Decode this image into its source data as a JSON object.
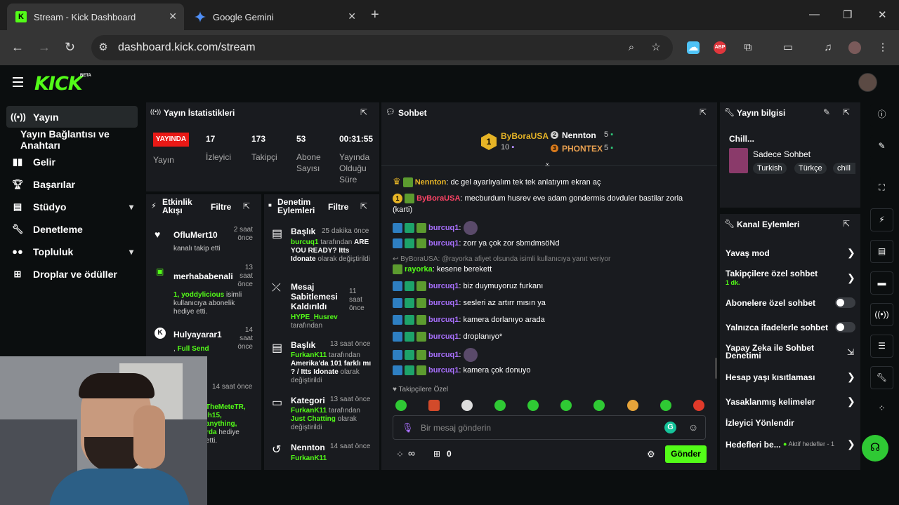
{
  "browser": {
    "tabs": [
      {
        "title": "Stream - Kick Dashboard",
        "active": true
      },
      {
        "title": "Google Gemini",
        "active": false
      }
    ],
    "url": "dashboard.kick.com/stream",
    "ext_abp": "ABP"
  },
  "kick": {
    "logo": "KICK",
    "beta": "BETA"
  },
  "sidebar": {
    "items": [
      {
        "label": "Yayın",
        "icon": "broadcast-icon"
      },
      {
        "label": "Yayın Bağlantısı ve Anahtarı",
        "icon": ""
      },
      {
        "label": "Gelir",
        "icon": "chart-icon"
      },
      {
        "label": "Başarılar",
        "icon": "trophy-icon"
      },
      {
        "label": "Stüdyo",
        "icon": "studio-icon"
      },
      {
        "label": "Denetleme",
        "icon": "wrench-icon"
      },
      {
        "label": "Topluluk",
        "icon": "community-icon"
      },
      {
        "label": "Droplar ve ödüller",
        "icon": "gift-icon"
      }
    ]
  },
  "stats": {
    "title": "Yayın İstatistikleri",
    "live": "YAYINDA",
    "live_label": "Yayın",
    "items": [
      {
        "value": "17",
        "label": "İzleyici"
      },
      {
        "value": "173",
        "label": "Takipçi"
      },
      {
        "value": "53",
        "label": "Abone Sayısı"
      },
      {
        "value": "00:31:55",
        "label": "Yayında Olduğu Süre"
      }
    ]
  },
  "activity": {
    "title": "Etkinlik Akışı",
    "filter": "Filtre",
    "items": [
      {
        "name": "OfluMert10",
        "time": "2 saat önce",
        "desc": "kanalı takip etti"
      },
      {
        "name": "merhababenali",
        "time": "13 saat önce",
        "desc_green": "1, yoddylicious",
        "desc": " isimli kullanıcıya abonelik hediye etti."
      },
      {
        "name": "Hulyayarar1",
        "time": "14 saat önce",
        "desc_prefix": ", ",
        "desc_green": "Full Send"
      },
      {
        "name": "",
        "time": "14 saat önce",
        "desc_green": "TheMeteTR, ih15, anything, rda",
        "desc": "hediye etti."
      }
    ]
  },
  "moderation": {
    "title": "Denetim Eylemleri",
    "filter": "Filtre",
    "items": [
      {
        "title": "Başlık",
        "time": "25 dakika önce",
        "user": "burcuq1",
        "mid": " tarafından ",
        "value": "ARE YOU READY? Itts Idonate",
        "tail": " olarak değiştirildi"
      },
      {
        "title": "Mesaj Sabitlemesi Kaldırıldı",
        "time": "11 saat önce",
        "user": "HYPE_Husrev",
        "tail": "tarafından"
      },
      {
        "title": "Başlık",
        "time": "13 saat önce",
        "user": "FurkanK11",
        "mid": " tarafından ",
        "value": "Amerika'da 101 farklı mı ? / Itts Idonate",
        "tail": " olarak değiştirildi"
      },
      {
        "title": "Kategori",
        "time": "13 saat önce",
        "user": "FurkanK11",
        "mid": " tarafından ",
        "value": "Just Chatting",
        "tail": " olarak değiştirildi"
      },
      {
        "title": "Nennton",
        "time": "14 saat önce",
        "user": "FurkanK11",
        "tail": ""
      }
    ]
  },
  "chat": {
    "title": "Sohbet",
    "leaders": [
      {
        "rank": "1",
        "name": "ByBoraUSA",
        "count": "10"
      },
      {
        "rank": "2",
        "name": "Nennton",
        "count": "5"
      },
      {
        "rank": "3",
        "name": "PHONTEX",
        "count": "5"
      }
    ],
    "messages": [
      {
        "user": "Nennton",
        "text": "dc gel ayarlıyalım tek tek anlatıyım ekran aç",
        "color": "gold"
      },
      {
        "user": "ByBoraUSA",
        "text": "mecburdum husrev eve adam gondermis dovduler bastilar zorla (karti)",
        "color": "red"
      },
      {
        "user": "burcuq1",
        "text": "",
        "color": "purple",
        "emote": true
      },
      {
        "user": "burcuq1",
        "text": "zorr ya çok zor sbmdmsöNd",
        "color": "purple"
      },
      {
        "reply": "ByBoraUSA: @rayorka afiyet olsunda isimli kullanıcıya yanıt veriyor"
      },
      {
        "user": "rayorka",
        "text": "kesene berekett",
        "color": "green"
      },
      {
        "user": "burcuq1",
        "text": "biz duymuyoruz furkanı",
        "color": "purple"
      },
      {
        "user": "burcuq1",
        "text": "sesleri az artırr mısın ya",
        "color": "purple"
      },
      {
        "user": "burcuq1",
        "text": "kamera dorlanıyo arada",
        "color": "purple"
      },
      {
        "user": "burcuq1",
        "text": "droplanıyo*",
        "color": "purple"
      },
      {
        "user": "burcuq1",
        "text": "",
        "color": "purple",
        "emote": true
      },
      {
        "user": "burcuq1",
        "text": "kamera çok donuyo",
        "color": "purple"
      }
    ],
    "emote_tab": "Takipçilere Özel",
    "input_placeholder": "Bir mesaj gönderin",
    "points": "∞",
    "drops": "0",
    "send": "Gönder"
  },
  "stream_info": {
    "title": "Yayın bilgisi",
    "stream_title": "Chill...",
    "category": "Sadece Sohbet",
    "tags": [
      "Turkish",
      "Türkçe",
      "chill"
    ]
  },
  "channel_actions": {
    "title": "Kanal Eylemleri",
    "items": [
      {
        "label": "Yavaş mod",
        "type": "chevron"
      },
      {
        "label": "Takipçilere özel sohbet",
        "sub": "1 dk.",
        "type": "chevron"
      },
      {
        "label": "Abonelere özel sohbet",
        "type": "toggle"
      },
      {
        "label": "Yalnızca ifadelerle sohbet",
        "type": "toggle"
      },
      {
        "label": "Yapay Zeka ile Sohbet Denetimi",
        "type": "external"
      },
      {
        "label": "Hesap yaşı kısıtlaması",
        "type": "chevron"
      },
      {
        "label": "Yasaklanmış kelimeler",
        "type": "chevron"
      },
      {
        "label": "İzleyici Yönlendir",
        "type": "none"
      },
      {
        "label": "Hedefleri be...",
        "sub": "Aktif hedefler - 1",
        "type": "chevron"
      }
    ]
  },
  "colors": {
    "kick_green": "#53fc18",
    "live_red": "#e91916",
    "panel": "#191b1f",
    "background": "#0b0e0f",
    "username_purple": "#a970ff"
  }
}
